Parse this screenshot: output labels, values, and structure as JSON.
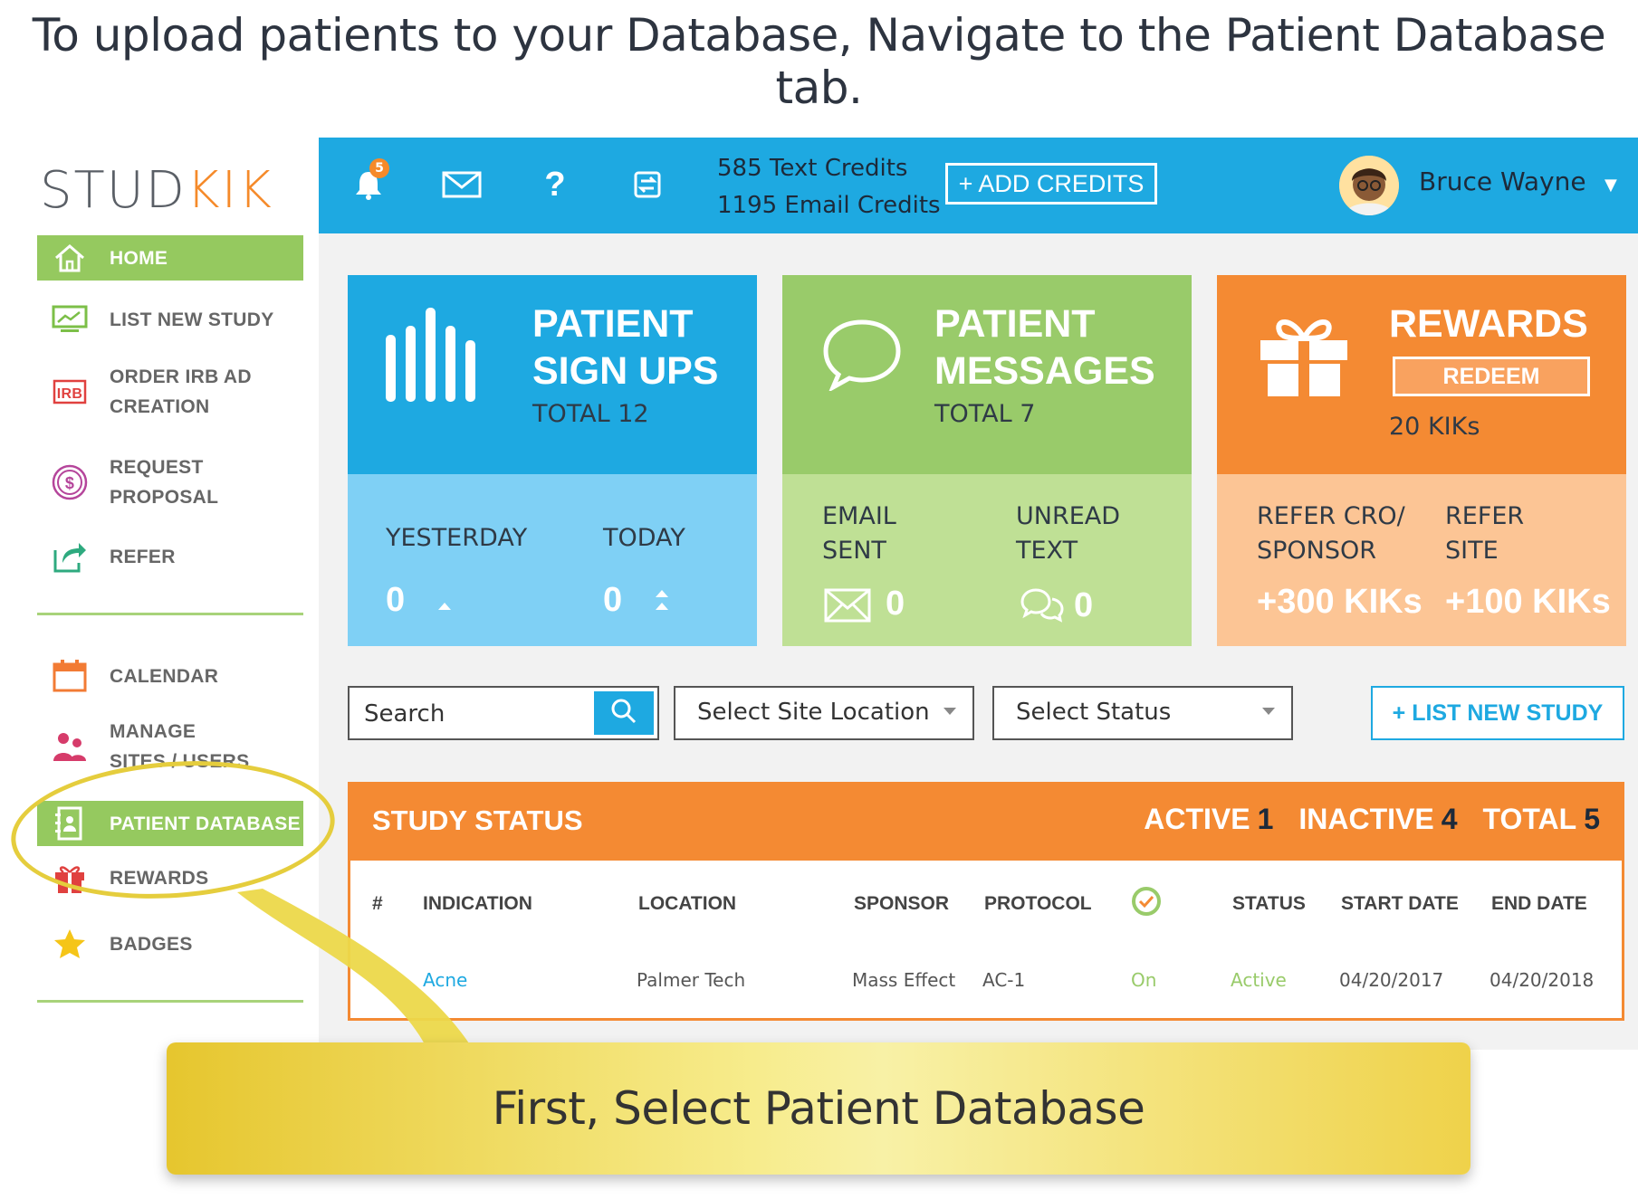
{
  "instruction": "To upload patients to your Database, Navigate to the Patient Database tab.",
  "logo": {
    "part1": "STUD",
    "part2": "KIK"
  },
  "sidebar": {
    "items": [
      {
        "label": "HOME",
        "icon": "home-icon"
      },
      {
        "label": "LIST NEW STUDY",
        "icon": "monitor-chart-icon"
      },
      {
        "label": "ORDER IRB AD",
        "label2": "CREATION",
        "icon": "irb-icon"
      },
      {
        "label": "REQUEST",
        "label2": "PROPOSAL",
        "icon": "dollar-circle-icon"
      },
      {
        "label": "REFER",
        "icon": "share-icon"
      },
      {
        "label": "CALENDAR",
        "icon": "calendar-icon"
      },
      {
        "label": "MANAGE",
        "label2": "SITES / USERS",
        "icon": "users-icon"
      },
      {
        "label": "PATIENT DATABASE",
        "icon": "address-book-icon"
      },
      {
        "label": "REWARDS",
        "icon": "gift-icon"
      },
      {
        "label": "BADGES",
        "icon": "star-icon"
      }
    ]
  },
  "topbar": {
    "notification_count": "5",
    "text_credits": "585 Text Credits",
    "email_credits": "1195 Email Credits",
    "add_credits": "+ ADD CREDITS",
    "user_name": "Bruce Wayne"
  },
  "cards": {
    "signups": {
      "title1": "PATIENT",
      "title2": "SIGN UPS",
      "total": "TOTAL 12",
      "yesterday_label": "YESTERDAY",
      "today_label": "TODAY",
      "yesterday": "0",
      "today": "0"
    },
    "messages": {
      "title1": "PATIENT",
      "title2": "MESSAGES",
      "total": "TOTAL 7",
      "email_label1": "EMAIL",
      "email_label2": "SENT",
      "unread_label1": "UNREAD",
      "unread_label2": "TEXT",
      "email_sent": "0",
      "unread_text": "0"
    },
    "rewards": {
      "title": "REWARDS",
      "redeem": "REDEEM",
      "kiks": "20 KIKs",
      "refer_cro1": "REFER CRO/",
      "refer_cro2": "SPONSOR",
      "refer_site1": "REFER",
      "refer_site2": "SITE",
      "cro_value": "+300 KIKs",
      "site_value": "+100 KIKs"
    }
  },
  "filters": {
    "search_placeholder": "Search",
    "site_location": "Select Site Location",
    "status": "Select Status",
    "list_new_study": "+ LIST NEW STUDY"
  },
  "study_status": {
    "title": "STUDY STATUS",
    "active_label": "ACTIVE",
    "active": "1",
    "inactive_label": "INACTIVE",
    "inactive": "4",
    "total_label": "TOTAL",
    "total": "5",
    "columns": [
      "#",
      "INDICATION",
      "LOCATION",
      "SPONSOR",
      "PROTOCOL",
      "STATUS",
      "START DATE",
      "END DATE"
    ],
    "rows": [
      {
        "indication": "Acne",
        "location": "Palmer Tech",
        "sponsor": "Mass Effect",
        "protocol": "AC-1",
        "toggle": "On",
        "status": "Active",
        "start_date": "04/20/2017",
        "end_date": "04/20/2018"
      }
    ]
  },
  "callout": "First, Select Patient Database",
  "colors": {
    "blue": "#1ea9e1",
    "green": "#99cb6a",
    "orange": "#f48a33",
    "highlight": "#e5cd3d"
  }
}
